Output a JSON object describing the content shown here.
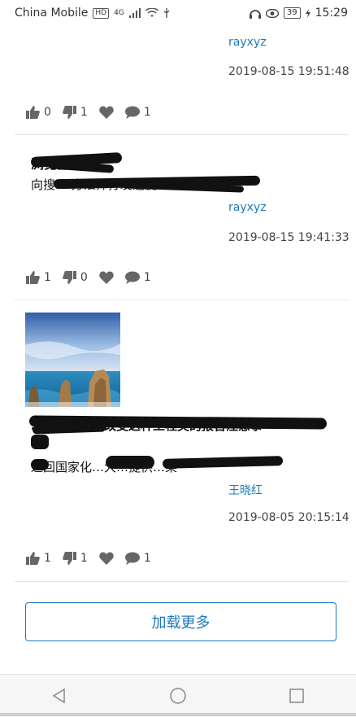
{
  "status_bar": {
    "carrier": "China Mobile",
    "hd_badge": "HD",
    "network": "4G",
    "battery": "39",
    "time": "15:29"
  },
  "posts": [
    {
      "author": "rayxyz",
      "date": "2019-08-15 19:51:48",
      "likes": "0",
      "dislikes": "1",
      "comments": "1"
    },
    {
      "title": "浏览器的打",
      "body": "向搜… 方法师打发速度… u",
      "author": "rayxyz",
      "date": "2019-08-15 19:41:33",
      "likes": "1",
      "dislikes": "0",
      "comments": "1"
    },
    {
      "title": "…有士很大的改变这种工程类的报告注意事",
      "body": "返回国家化…大…提供…某",
      "author": "王晓红",
      "date": "2019-08-05 20:15:14",
      "likes": "1",
      "dislikes": "1",
      "comments": "1"
    }
  ],
  "load_more_label": "加载更多",
  "icons": {
    "thumbs_up": "thumbs-up-icon",
    "thumbs_down": "thumbs-down-icon",
    "heart": "heart-icon",
    "comment": "comment-icon",
    "back": "back-triangle-icon",
    "home": "home-circle-icon",
    "recents": "recents-square-icon"
  },
  "colors": {
    "accent": "#1f7ab8",
    "divider": "#e6e6e6",
    "icon": "#666666"
  }
}
